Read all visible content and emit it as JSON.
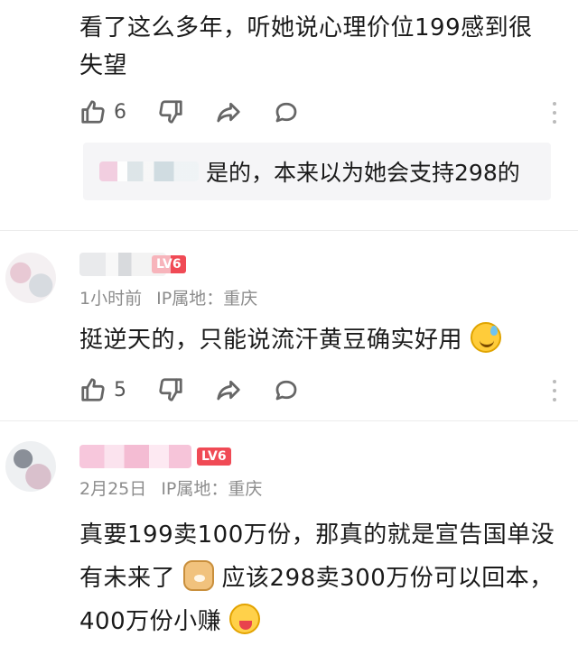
{
  "comments": [
    {
      "text": "看了这么多年，听她说心理价位199感到很失望",
      "likes": "6",
      "reply": {
        "text": "是的，本来以为她会支持298的"
      }
    },
    {
      "time": "1小时前",
      "ip": "IP属地：重庆",
      "level": "LV6",
      "text": "挺逆天的，只能说流汗黄豆确实好用",
      "emoji": "sweat-emoji",
      "likes": "5"
    },
    {
      "time": "2月25日",
      "ip": "IP属地：重庆",
      "level": "LV6",
      "text_part1": "真要199卖100万份，那真的就是宣告国单没有未来了",
      "emoji1": "doge-emoji",
      "text_part2": "应该298卖300万份可以回本，400万份小赚",
      "emoji2": "money-emoji"
    }
  ],
  "icons": {
    "like": "thumbs-up-icon",
    "dislike": "thumbs-down-icon",
    "share": "share-icon",
    "reply": "comment-bubble-icon",
    "more": "more-vertical-icon"
  },
  "colors": {
    "level_badge": "#f04a55",
    "meta_text": "#8c8c8c"
  }
}
